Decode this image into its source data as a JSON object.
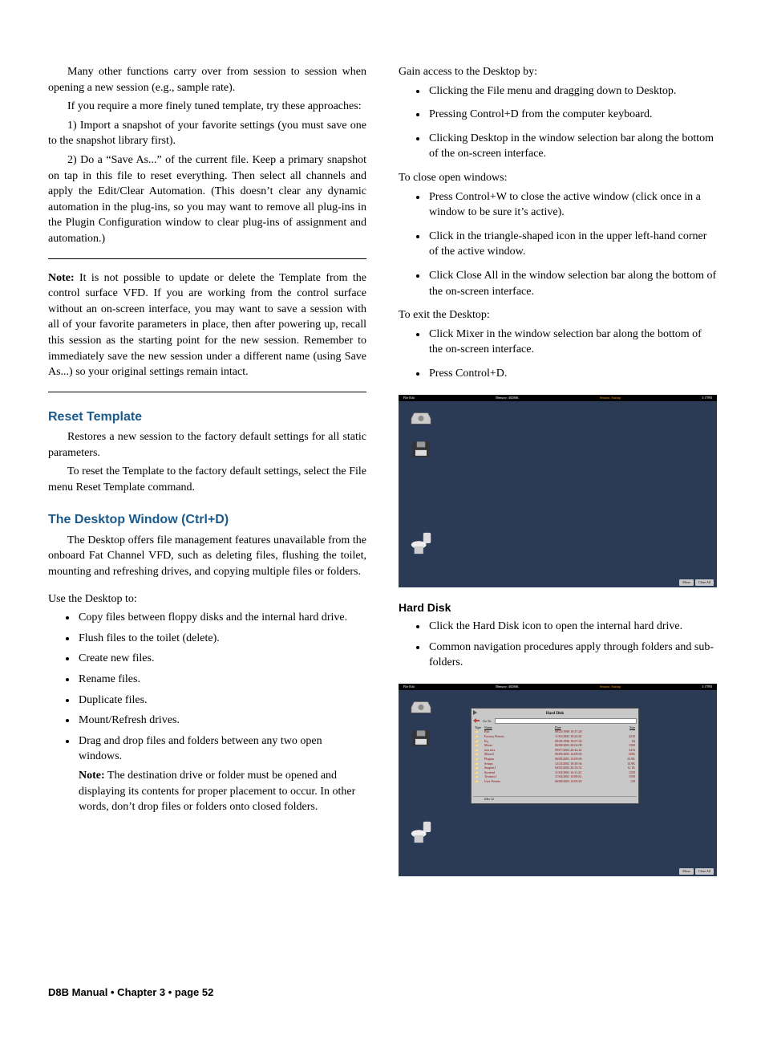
{
  "left": {
    "intro1": "Many other functions carry over from session to session when opening a new session (e.g., sample rate).",
    "intro2": "If you require a more finely tuned template, try these approaches:",
    "step1": "1) Import a snapshot of your favorite settings (you must save one to the snapshot library first).",
    "step2": "2) Do a “Save As...” of the current file. Keep a primary snapshot on tap in this file to reset everything. Then select all channels and apply the Edit/Clear Automation. (This doesn’t clear any dynamic automation in the plug-ins, so you may want to remove all plug-ins in the Plugin Configuration window to clear plug-ins of assignment and automation.)",
    "note_label": "Note:",
    "note_body": " It is not possible to update or delete the Template from the control surface VFD. If you are working from the control surface without an on-screen interface, you may want to save a session with all of your favorite parameters in place, then after powering up, recall this session as the starting point for the new session. Remember to immediately save the new session under a different name (using Save As...) so your original settings remain intact.",
    "h_reset": "Reset Template",
    "reset_p1": "Restores a new session to the factory default settings for all static parameters.",
    "reset_p2": "To reset the Template to the factory default settings, select the File menu Reset Template command.",
    "h_desktop": "The Desktop Window (Ctrl+D)",
    "desktop_p1": "The Desktop offers file management features unavailable from the onboard Fat Channel VFD, such as deleting files, flushing the toilet, mounting and refreshing drives, and copying multiple files or folders.",
    "desktop_use": "Use the Desktop to:",
    "desktop_items": [
      "Copy files between floppy disks and the internal hard drive.",
      "Flush files to the toilet (delete).",
      "Create new files.",
      "Rename files.",
      "Duplicate files.",
      "Mount/Refresh drives.",
      "Drag and drop files and folders between any two open windows."
    ],
    "desktop_subnote_label": "Note:",
    "desktop_subnote_body": " The destination drive or folder must be opened and displaying its contents for proper placement to occur. In other words, don’t drop files or folders onto closed folders."
  },
  "right": {
    "gain_intro": "Gain access to the Desktop by:",
    "gain_items": [
      "Clicking the File menu and dragging down to Desktop.",
      "Pressing Control+D from the computer keyboard.",
      "Clicking Desktop in the window selection bar along the bottom of the on-screen interface."
    ],
    "close_intro": "To close open windows:",
    "close_items": [
      "Press Control+W to close the active window (click once in a window to be sure it’s active).",
      "Click in the triangle-shaped icon in the upper left-hand corner of the active window.",
      "Click Close All in the window selection bar along the bottom of the on-screen interface."
    ],
    "exit_intro": "To exit the Desktop:",
    "exit_items": [
      "Click Mixer in the window selection bar along the bottom of the on-screen interface.",
      "Press Control+D."
    ],
    "h_hard": "Hard Disk",
    "hard_items": [
      "Click the Hard Disk icon to open the internal hard drive.",
      "Common navigation procedures apply through folders and sub-folders."
    ]
  },
  "fig": {
    "bar_left": "File  Edit",
    "bar_mid": "Memory: 48206K",
    "bar_right_label": "Session:",
    "bar_right_val": "Startup",
    "bar_time1": "3:17PM",
    "bar_time2": "3:17PM",
    "btn_mixer": "Mixer",
    "btn_close": "Close All",
    "filewin_title": "Hard Disk",
    "filewin_goto": "Go To:",
    "columns": {
      "type": "Type",
      "name": "Name",
      "date": "Date",
      "size": "Size"
    },
    "rows": [
      {
        "name": "Bin",
        "date": "08/23/1998   19:37:28",
        "size": ""
      },
      {
        "name": "Factory Presets",
        "date": "11/02/2002   18:24:20",
        "size": "4230"
      },
      {
        "name": "Eq",
        "date": "09/20/1998   19:07:36",
        "size": "84"
      },
      {
        "name": "Mixes",
        "date": "06/08/2003   20:02:08",
        "size": "1500"
      },
      {
        "name": "mix.mix",
        "date": "09/07/2002   20:42:42",
        "size": "3416"
      },
      {
        "name": "Mixes2",
        "date": "06/09/2003   14:09:06",
        "size": "135K"
      },
      {
        "name": "Plugins",
        "date": "06/09/2003   14:09:06",
        "size": "24.9K"
      },
      {
        "name": "Setups",
        "date": "12/24/2002   10:49:36",
        "size": "14.9K"
      },
      {
        "name": "Snapset1",
        "date": "04/02/2002   20:33:52",
        "size": "12.1K"
      },
      {
        "name": "System1",
        "date": "11/04/2002   14:11:22",
        "size": "1250"
      },
      {
        "name": "Textmix1",
        "date": "11/04/2002   14:08:02",
        "size": "1500"
      },
      {
        "name": "User Presets",
        "date": "06/08/2003   14:09:20",
        "size": "120"
      }
    ],
    "row_count_label": "files",
    "row_count": "12"
  },
  "footer": "D8B Manual • Chapter 3 • page  52"
}
